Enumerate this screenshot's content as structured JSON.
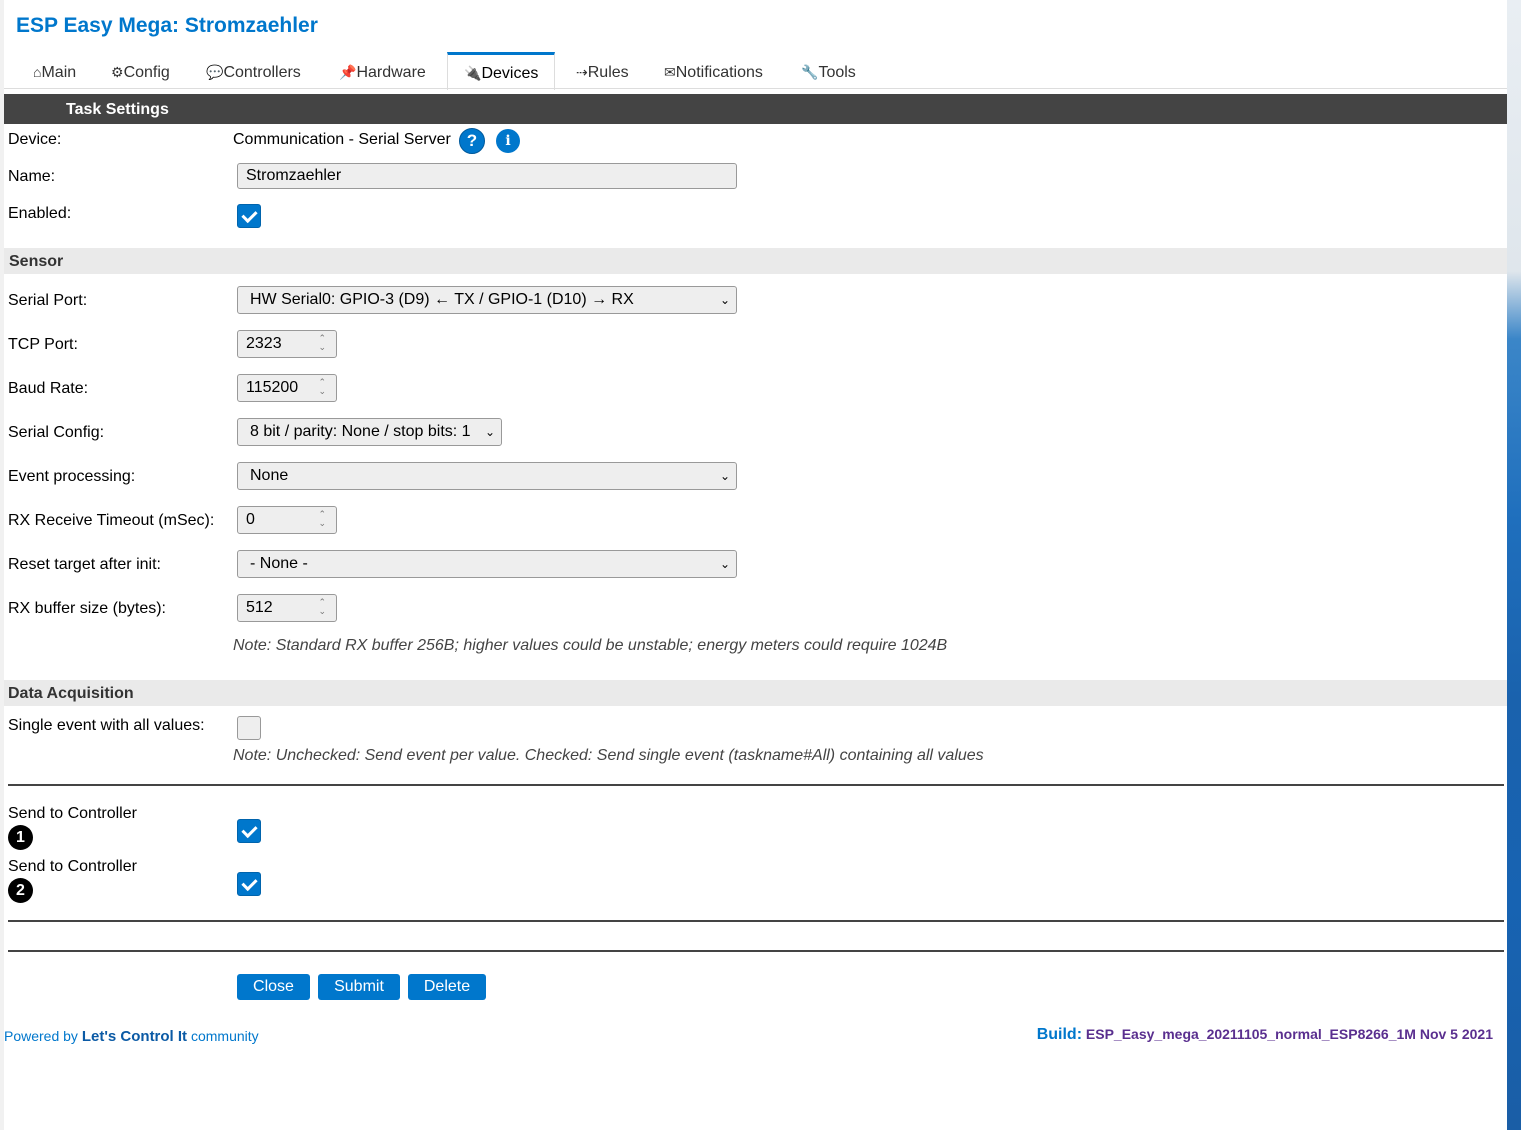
{
  "app": {
    "title": "ESP Easy Mega: Stromzaehler"
  },
  "tabs": [
    {
      "icon": "⌂",
      "label": "Main"
    },
    {
      "icon": "⚙",
      "label": "Config"
    },
    {
      "icon": "💬",
      "label": "Controllers"
    },
    {
      "icon": "📌",
      "label": "Hardware"
    },
    {
      "icon": "🔌",
      "label": "Devices"
    },
    {
      "icon": "⇢",
      "label": "Rules"
    },
    {
      "icon": "✉",
      "label": "Notifications"
    },
    {
      "icon": "🔧",
      "label": "Tools"
    }
  ],
  "active_tab": "Devices",
  "header": {
    "title": "Task Settings"
  },
  "task": {
    "device_label": "Device:",
    "device_value": "Communication - Serial Server",
    "help_glyph": "?",
    "info_glyph": "i",
    "name_label": "Name:",
    "name_value": "Stromzaehler",
    "enabled_label": "Enabled:",
    "enabled": true
  },
  "sensor": {
    "section_title": "Sensor",
    "serial_port_label": "Serial Port:",
    "serial_port_value": "HW Serial0: GPIO-3 (D9) ← TX / GPIO-1 (D10) → RX",
    "tcp_port_label": "TCP Port:",
    "tcp_port_value": "2323",
    "baud_rate_label": "Baud Rate:",
    "baud_rate_value": "115200",
    "serial_config_label": "Serial Config:",
    "serial_config_value": "8 bit / parity: None / stop bits: 1",
    "event_processing_label": "Event processing:",
    "event_processing_value": "None",
    "rx_timeout_label": "RX Receive Timeout (mSec):",
    "rx_timeout_value": "0",
    "reset_target_label": "Reset target after init:",
    "reset_target_value": "- None -",
    "rx_buffer_label": "RX buffer size (bytes):",
    "rx_buffer_value": "512",
    "rx_buffer_note": "Note: Standard RX buffer 256B; higher values could be unstable; energy meters could require 1024B"
  },
  "data_acquisition": {
    "section_title": "Data Acquisition",
    "single_event_label": "Single event with all values:",
    "single_event": false,
    "single_event_note": "Note: Unchecked: Send event per value. Checked: Send single event (taskname#All) containing all values",
    "controllers": [
      {
        "label": "Send to Controller",
        "badge": "1",
        "checked": true
      },
      {
        "label": "Send to Controller",
        "badge": "2",
        "checked": true
      }
    ]
  },
  "buttons": {
    "close": "Close",
    "submit": "Submit",
    "delete": "Delete"
  },
  "footer": {
    "powered_by": "Powered by",
    "brand": "Let's Control It",
    "community": "community",
    "build_label": "Build:",
    "build_value": "ESP_Easy_mega_20211105_normal_ESP8266_1M Nov 5 2021"
  },
  "colors": {
    "accent": "#0077cc",
    "header_bg": "#444444",
    "section_bg": "#eaeaea",
    "build_value": "#5a2f8f"
  }
}
